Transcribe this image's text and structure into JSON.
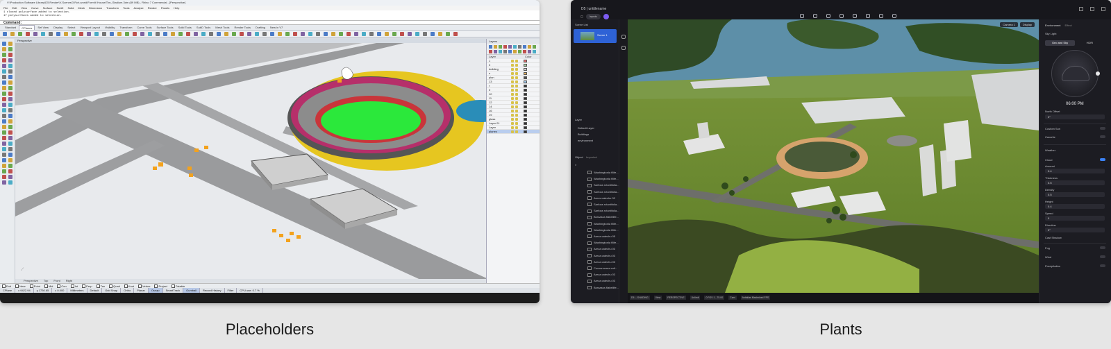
{
  "captions": {
    "left": "Placeholders",
    "right": "Plants"
  },
  "rhino": {
    "title": "V:\\Production Software Library\\D5 Render\\V-Scenes\\3 Rch-world\\FormIt \\House\\Tlm_Stadium.3dm (89 MB) - Rhino 7 Commercial - [Perspective]",
    "menu": [
      "File",
      "Edit",
      "View",
      "Curve",
      "Surface",
      "SubD",
      "Solid",
      "Mesh",
      "Dimension",
      "Transform",
      "Tools",
      "Analyze",
      "Render",
      "Panels",
      "Help"
    ],
    "history": [
      "1 closed polysurface added to selection.",
      "17 polysurfaces added to selection."
    ],
    "command_label": "Command:",
    "tabs": [
      "Standard",
      "CPlanes",
      "Set View",
      "Display",
      "Select",
      "Viewport Layout",
      "Visibility",
      "Transform",
      "Curve Tools",
      "Surface Tools",
      "Solid Tools",
      "SubD Tools",
      "Mesh Tools",
      "Render Tools",
      "Drafting",
      "New in V7"
    ],
    "active_tab": "CPlanes",
    "viewport_name": "Perspective",
    "view_tabs": [
      "Perspective",
      "Top",
      "Front",
      "Right"
    ],
    "osnaps": [
      "End",
      "Near",
      "Point",
      "Mid",
      "Cen",
      "Int",
      "Perp",
      "Tan",
      "Quad",
      "Knot",
      "Vertex",
      "Project",
      "Disable"
    ],
    "status": [
      "CPlane",
      "x 9422.94",
      "y 1730.65",
      "z 0.000",
      "Millimeters",
      "Default",
      "Grid Snap",
      "Ortho",
      "Planar",
      "Osnap",
      "SmartTrack",
      "Gumball",
      "Record History",
      "Filter",
      "CPU use: 0.7 %"
    ],
    "status_highlighted": [
      "Osnap",
      "Gumball"
    ],
    "layers_panel": {
      "title": "Layers",
      "columns": [
        "Layer",
        "Color"
      ],
      "rows": [
        {
          "name": "1",
          "color": "#e36b6b"
        },
        {
          "name": "3",
          "color": "#9fc99a"
        },
        {
          "name": "building",
          "color": "#cccccc"
        },
        {
          "name": "n",
          "color": "#e4b25c"
        },
        {
          "name": "plan",
          "color": "#4d4d4d"
        },
        {
          "name": "13",
          "color": "#9fc8e8"
        },
        {
          "name": "r",
          "color": "#303030"
        },
        {
          "name": "0",
          "color": "#303030"
        },
        {
          "name": "10",
          "color": "#303030"
        },
        {
          "name": "11",
          "color": "#303030"
        },
        {
          "name": "12",
          "color": "#303030"
        },
        {
          "name": "14",
          "color": "#303030"
        },
        {
          "name": "16",
          "color": "#303030"
        },
        {
          "name": "19",
          "color": "#303030"
        },
        {
          "name": "glass",
          "color": "#303030"
        },
        {
          "name": "Layer 01",
          "color": "#303030"
        },
        {
          "name": "Layer",
          "color": "#303030"
        },
        {
          "name": "planes",
          "color": "#303030"
        }
      ],
      "selected_row": "planes"
    }
  },
  "d5": {
    "app_name": "D5 | untitlename",
    "tab_label": "Inputs",
    "scene_list_label": "Scene List",
    "scene_name": "Scene 1",
    "layer_label": "Layer",
    "layers": [
      "Default Layer",
      "Buildings",
      "environment"
    ],
    "object_tab": "Object",
    "imported_tab": "Imported",
    "objects": [
      "Washingtonia filife...",
      "Washingtonia filife...",
      "Sarfous rctuntifolia...",
      "Sarfous rctuntifolia...",
      "Arecs catechu 03",
      "Sarfous rctuntifolia...",
      "Sarfous rctuntifolia...",
      "Boraasus flabellife...",
      "Washingtonia filife...",
      "Washingtonia filife...",
      "Areca catechu 05",
      "Washingtonia filife...",
      "Areca catechu 03",
      "Areca catechu 03",
      "Areca catechu 03",
      "Cocosnucrea cult...",
      "Areca catechu 03",
      "Areca catechu 03",
      "Boraasus flabellife..."
    ],
    "view_buttons": [
      "Camera 1",
      "Display"
    ],
    "view_status": [
      "D5 -- SHADING",
      "View",
      "PERSPECTIVE",
      "Unlimit",
      "0 FOV 1 , 75.00",
      "Cam",
      "Antialias Maximized FPS"
    ],
    "right_tabs": [
      "Environment",
      "Effect"
    ],
    "sky_light": "Sky Light",
    "seg": [
      "Geo and Sky",
      "HDRI"
    ],
    "time": "06:00 PM",
    "north_offset_label": "North Offset",
    "north_offset": "0°",
    "custom_sun": "Custom Sun",
    "cavorite": "Cavorite",
    "weather": "Weather",
    "cloud": "Cloud",
    "amount_label": "Amount",
    "amount": "0.4",
    "thickness_label": "Thickness",
    "thickness": "0.5",
    "density_label": "Density",
    "density": "0.5",
    "height_label": "Height",
    "height": "0.4",
    "speed_label": "Speed",
    "speed": "0",
    "direction_label": "Direction",
    "direction": "0°",
    "cast_shadow": "Cast Shadow",
    "fog": "Fog",
    "wind": "Wind",
    "precipitation": "Precipitation"
  }
}
